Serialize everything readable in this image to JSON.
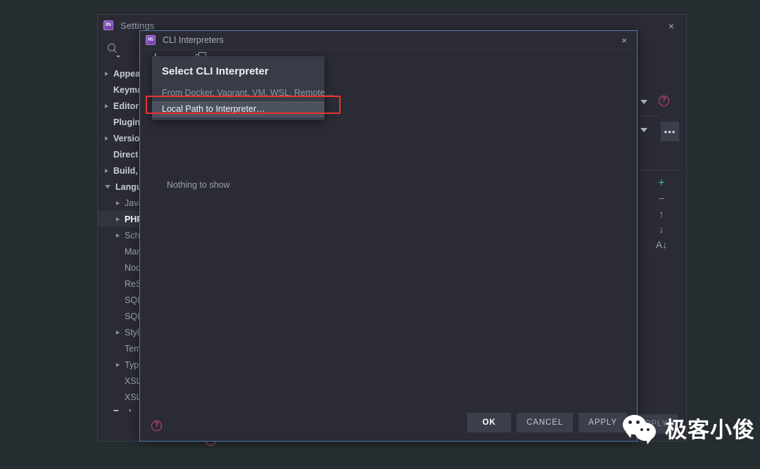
{
  "app": {
    "icon": "phpstorm-icon",
    "icon_text": "PS"
  },
  "settings_window": {
    "title": "Settings",
    "close_label": "×",
    "search": {
      "icon": "search-icon",
      "placeholder": ""
    },
    "tree": [
      {
        "label": "Appea",
        "arrow": "closed",
        "style": "bold",
        "indent": 0
      },
      {
        "label": "Keyma",
        "arrow": "none",
        "style": "bold",
        "indent": 0
      },
      {
        "label": "Editor",
        "arrow": "closed",
        "style": "bold",
        "indent": 0
      },
      {
        "label": "Plugin",
        "arrow": "none",
        "style": "bold",
        "indent": 0
      },
      {
        "label": "Versio",
        "arrow": "closed",
        "style": "bold",
        "indent": 0
      },
      {
        "label": "Direct",
        "arrow": "none",
        "style": "bold",
        "indent": 0
      },
      {
        "label": "Build,",
        "arrow": "closed",
        "style": "bold",
        "indent": 0
      },
      {
        "label": "Langu",
        "arrow": "open",
        "style": "bold",
        "indent": 0
      },
      {
        "label": "Java",
        "arrow": "closed",
        "style": "plain",
        "indent": 1
      },
      {
        "label": "PHP",
        "arrow": "closed",
        "style": "sel",
        "indent": 1
      },
      {
        "label": "Sch",
        "arrow": "closed",
        "style": "plain",
        "indent": 1
      },
      {
        "label": "Mar",
        "arrow": "none",
        "style": "plain",
        "indent": 1
      },
      {
        "label": "Nod",
        "arrow": "none",
        "style": "plain",
        "indent": 1
      },
      {
        "label": "ReS",
        "arrow": "none",
        "style": "plain",
        "indent": 1
      },
      {
        "label": "SQL",
        "arrow": "none",
        "style": "plain",
        "indent": 1
      },
      {
        "label": "SQL",
        "arrow": "none",
        "style": "plain",
        "indent": 1
      },
      {
        "label": "Styl",
        "arrow": "closed",
        "style": "plain",
        "indent": 1
      },
      {
        "label": "Tem",
        "arrow": "none",
        "style": "plain",
        "indent": 1
      },
      {
        "label": "Typ",
        "arrow": "closed",
        "style": "plain",
        "indent": 1
      },
      {
        "label": "XSL",
        "arrow": "none",
        "style": "plain",
        "indent": 1
      },
      {
        "label": "XSL",
        "arrow": "none",
        "style": "plain",
        "indent": 1
      },
      {
        "label": "Tools",
        "arrow": "closed",
        "style": "bold",
        "indent": 0
      }
    ],
    "help_icon": "help-icon",
    "help_glyph": "?",
    "right_panel": {
      "dropdown_icon": "chevron-down-icon",
      "help_icon": "help-icon",
      "ellipsis_label": "•••",
      "tools": [
        {
          "icon": "add-icon",
          "glyph": "+",
          "accent": "#2fb3ac"
        },
        {
          "icon": "remove-icon",
          "glyph": "−"
        },
        {
          "icon": "move-up-icon",
          "glyph": "↑"
        },
        {
          "icon": "move-down-icon",
          "glyph": "↓"
        },
        {
          "icon": "sort-alpha-icon",
          "glyph": "A↓"
        }
      ]
    },
    "footer_buttons": [
      {
        "label": "APPLY",
        "name": "settings-apply-button",
        "style": "dim"
      }
    ]
  },
  "cli_dialog": {
    "title": "CLI Interpreters",
    "close_label": "×",
    "toolbar": [
      {
        "icon": "add-interpreter-icon",
        "name": "add-button"
      },
      {
        "icon": "remove-interpreter-icon",
        "name": "remove-button"
      },
      {
        "icon": "copy-interpreter-icon",
        "name": "copy-button"
      }
    ],
    "empty_text": "Nothing to show",
    "help_icon": "help-icon",
    "help_glyph": "?",
    "buttons": [
      {
        "label": "OK",
        "name": "ok-button",
        "primary": true
      },
      {
        "label": "CANCEL",
        "name": "cancel-button",
        "primary": false
      },
      {
        "label": "APPLY",
        "name": "apply-button",
        "primary": false
      }
    ]
  },
  "interpreter_popup": {
    "heading": "Select CLI Interpreter",
    "items": [
      {
        "label": "From Docker, Vagrant, VM, WSL, Remote…",
        "name": "popup-item-remote",
        "highlighted": false
      },
      {
        "label": "Local Path to Interpreter…",
        "name": "popup-item-local",
        "highlighted": true
      }
    ]
  },
  "annotation": {
    "color": "#e8332e",
    "target": "Local Path to Interpreter…"
  },
  "watermark": {
    "text": "极客小俊",
    "logo": "wechat-logo"
  }
}
